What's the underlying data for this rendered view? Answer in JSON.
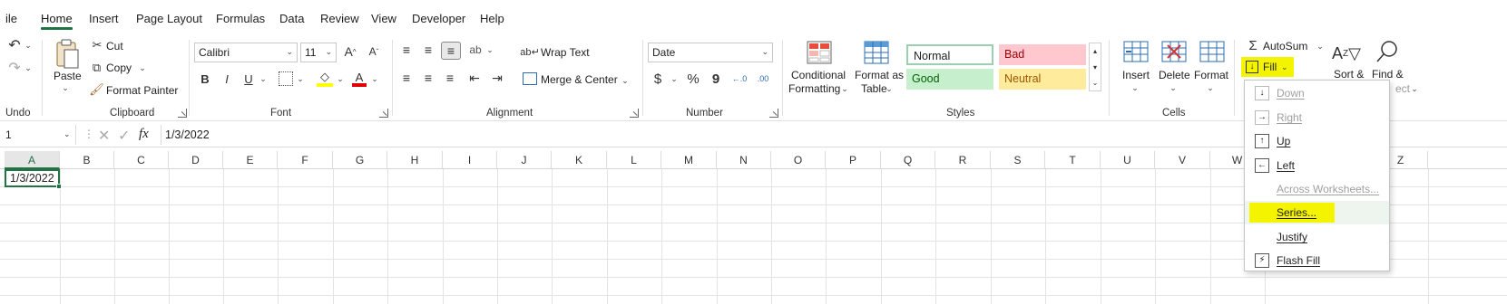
{
  "tabs": [
    "ile",
    "Home",
    "Insert",
    "Page Layout",
    "Formulas",
    "Data",
    "Review",
    "View",
    "Developer",
    "Help"
  ],
  "active_tab": "Home",
  "groups": {
    "undo": {
      "label": "Undo"
    },
    "clipboard": {
      "label": "Clipboard",
      "paste": "Paste",
      "cut": "Cut",
      "copy": "Copy",
      "format_painter": "Format Painter"
    },
    "font": {
      "label": "Font",
      "font_name": "Calibri",
      "font_size": "11",
      "bold": "B",
      "italic": "I",
      "underline": "U"
    },
    "alignment": {
      "label": "Alignment",
      "wrap_text": "Wrap Text",
      "merge_center": "Merge & Center"
    },
    "number": {
      "label": "Number",
      "format": "Date",
      "currency": "$",
      "percent": "%",
      "comma": "9"
    },
    "styles": {
      "label": "Styles",
      "conditional_formatting": [
        "Conditional",
        "Formatting"
      ],
      "format_as_table": [
        "Format as",
        "Table"
      ],
      "normal": "Normal",
      "bad": "Bad",
      "good": "Good",
      "neutral": "Neutral"
    },
    "cells": {
      "label": "Cells",
      "insert": "Insert",
      "delete": "Delete",
      "format": "Format"
    },
    "editing": {
      "autosum": "AutoSum",
      "fill": "Fill",
      "sort": "Sort &",
      "find": "Find &",
      "ect": "ect"
    }
  },
  "formula_bar": {
    "name_box": "1",
    "fx": "fx",
    "value": "1/3/2022"
  },
  "columns": [
    "A",
    "B",
    "C",
    "D",
    "E",
    "F",
    "G",
    "H",
    "I",
    "J",
    "K",
    "L",
    "M",
    "N",
    "O",
    "P",
    "Q",
    "R",
    "S",
    "T",
    "U",
    "V",
    "W",
    "Z"
  ],
  "cell_a1": "1/3/2022",
  "fill_menu": [
    {
      "label": "Down",
      "disabled": true
    },
    {
      "label": "Right",
      "disabled": true
    },
    {
      "label": "Up",
      "disabled": false
    },
    {
      "label": "Left",
      "disabled": false
    },
    {
      "label": "Across Worksheets...",
      "disabled": true
    },
    {
      "label": "Series...",
      "disabled": false
    },
    {
      "label": "Justify",
      "disabled": false
    },
    {
      "label": "Flash Fill",
      "disabled": false
    }
  ],
  "colors": {
    "accent": "#217346",
    "highlight": "#f4f400",
    "bad_bg": "#ffc7ce",
    "bad_fg": "#9c0006",
    "good_bg": "#c6efce",
    "good_fg": "#006100",
    "neutral_bg": "#ffeb9c",
    "neutral_fg": "#9c5700"
  }
}
